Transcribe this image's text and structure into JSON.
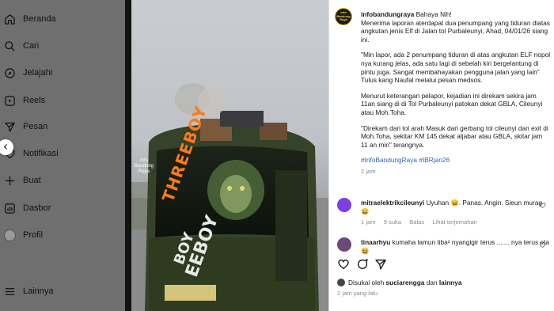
{
  "sidebar": {
    "items": [
      {
        "label": "Beranda",
        "icon": "home-icon"
      },
      {
        "label": "Cari",
        "icon": "search-icon"
      },
      {
        "label": "Jelajahi",
        "icon": "compass-icon"
      },
      {
        "label": "Reels",
        "icon": "reels-icon"
      },
      {
        "label": "Pesan",
        "icon": "send-icon"
      },
      {
        "label": "Notifikasi",
        "icon": "heart-icon"
      },
      {
        "label": "Buat",
        "icon": "plus-icon"
      },
      {
        "label": "Dasbor",
        "icon": "dashboard-icon"
      },
      {
        "label": "Profil",
        "icon": "avatar"
      }
    ],
    "more_label": "Lainnya"
  },
  "media": {
    "watermark_text": "Info Bandung Raya",
    "bus_text_top": "THREEBOY",
    "bus_text_mid": "BOY",
    "bus_text_bottom": "EEBOY"
  },
  "post": {
    "avatar_text": "Info Bandung Raya",
    "username": "infobandungraya",
    "title": "Bahaya Nih!",
    "paragraphs": [
      "Menerima laporan aterdapat dua penumpang yang tiduran diatas angkutan jenis Elf di Jalan tol Purbaleunyi, Ahad, 04/01/26 siang ini.",
      "\"Min lapor, ada 2 penumpang tiduran di atas angkutan ELF nopol nya kurang jelas, ada satu lagi di sebelah kiri bergelantung di pintu juga. Sangat membahayakan pengguna jalan yang lain\" Tulus kang Naufal melalui pesan medsos.",
      "Menurut keterangan pelapor, kejadian ini direkam sekira jam 11an siang di di Tol Purbaleunyi patokan dekat GBLA, Cileunyi atau Moh.Toha.",
      "\"Direkam dari tol arah Masuk dari gerbang tol cileunyi dan exit di Moh.Toha, sekitar KM 145 dekat aljabar atau GBLA, skitar jam 11 an min\" terangnya."
    ],
    "hashtags": "#InfoBandungRaya #IBRjan26",
    "time": "2 jam"
  },
  "comments": [
    {
      "username": "mitraelektrikcileunyi",
      "text": "Uyuhan 😄. Panas. Angin. Sieun murag 😄",
      "time": "1 jam",
      "likes": "9 suka",
      "reply": "Balas",
      "translate": "Lihat terjemahan",
      "avatar_color": "#7b3fe4"
    },
    {
      "username": "tinaarhyu",
      "text": "kumaha lamun tiba² nyangigir terus ....... nya terus eta😆",
      "avatar_color": "#6b4a7a"
    }
  ],
  "actions": {
    "liked_by_prefix": "Disukai oleh",
    "liked_by_user": "suciarengga",
    "liked_by_and": "dan",
    "liked_by_others": "lainnya",
    "time_ago": "2 jam yang lalu"
  },
  "colors": {
    "sidebar_bg": "#6f6f6f",
    "hashtag": "#2b63c5",
    "bus_green": "#2e3b1f",
    "bus_text": "#e8e8e8"
  }
}
